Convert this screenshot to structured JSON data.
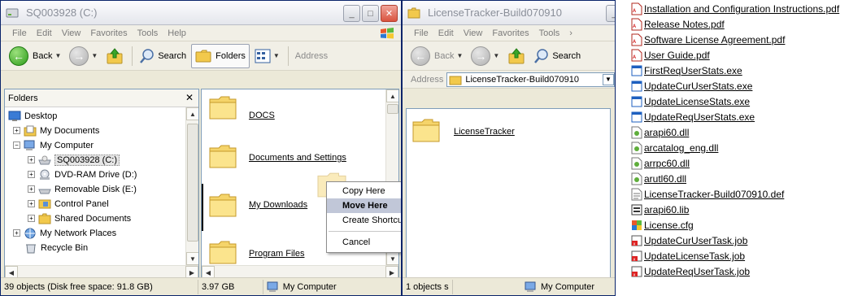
{
  "left_window": {
    "title": "SQ003928 (C:)",
    "menu": [
      "File",
      "Edit",
      "View",
      "Favorites",
      "Tools",
      "Help"
    ],
    "toolbar": {
      "back": "Back",
      "search": "Search",
      "folders": "Folders",
      "address": "Address"
    },
    "folders_pane": {
      "header": "Folders",
      "tree": [
        {
          "label": "Desktop",
          "icon": "desktop-icon"
        },
        {
          "label": "My Documents",
          "icon": "my-documents-icon",
          "expander": "+"
        },
        {
          "label": "My Computer",
          "icon": "my-computer-icon",
          "expander": "−"
        },
        {
          "label": "SQ003928 (C:)",
          "icon": "hard-drive-icon",
          "expander": "+",
          "selected": true
        },
        {
          "label": "DVD-RAM Drive (D:)",
          "icon": "dvd-drive-icon",
          "expander": "+"
        },
        {
          "label": "Removable Disk (E:)",
          "icon": "removable-disk-icon",
          "expander": "+"
        },
        {
          "label": "Control Panel",
          "icon": "control-panel-icon",
          "expander": "+"
        },
        {
          "label": "Shared Documents",
          "icon": "folder-icon",
          "expander": "+"
        },
        {
          "label": "My Network Places",
          "icon": "network-places-icon",
          "expander": "+"
        },
        {
          "label": "Recycle Bin",
          "icon": "recycle-bin-icon"
        }
      ]
    },
    "folder_items": [
      "DOCS",
      "Documents and Settings",
      "My Downloads",
      "Program Files"
    ],
    "context_menu": {
      "items": [
        "Copy Here",
        "Move Here",
        "Create Shortcuts Here"
      ],
      "cancel": "Cancel"
    },
    "status": {
      "objects": "39 objects (Disk free space: 91.8 GB)",
      "size": "3.97 GB",
      "location": "My Computer"
    }
  },
  "middle_window": {
    "title": "LicenseTracker-Build070910",
    "menu": [
      "File",
      "Edit",
      "View",
      "Favorites",
      "Tools"
    ],
    "toolbar": {
      "back": "Back",
      "search": "Search"
    },
    "address_label": "Address",
    "address_value": "LicenseTracker-Build070910",
    "folder_items": [
      "LicenseTracker"
    ],
    "status": {
      "objects": "1 objects s",
      "location": "My Computer"
    }
  },
  "file_list": [
    {
      "name": "Installation and Configuration Instructions.pdf",
      "type": "pdf"
    },
    {
      "name": "Release Notes.pdf",
      "type": "pdf"
    },
    {
      "name": "Software License Agreement.pdf",
      "type": "pdf"
    },
    {
      "name": "User Guide.pdf",
      "type": "pdf"
    },
    {
      "name": "FirstReqUserStats.exe",
      "type": "exe"
    },
    {
      "name": "UpdateCurUserStats.exe",
      "type": "exe"
    },
    {
      "name": "UpdateLicenseStats.exe",
      "type": "exe"
    },
    {
      "name": "UpdateReqUserStats.exe",
      "type": "exe"
    },
    {
      "name": "arapi60.dll",
      "type": "dll"
    },
    {
      "name": "arcatalog_eng.dll",
      "type": "dll"
    },
    {
      "name": "arrpc60.dll",
      "type": "dll"
    },
    {
      "name": "arutl60.dll",
      "type": "dll"
    },
    {
      "name": "LicenseTracker-Build070910.def",
      "type": "def"
    },
    {
      "name": "arapi60.lib",
      "type": "lib"
    },
    {
      "name": "License.cfg",
      "type": "cfg"
    },
    {
      "name": "UpdateCurUserTask.job",
      "type": "job"
    },
    {
      "name": "UpdateLicenseTask.job",
      "type": "job"
    },
    {
      "name": "UpdateReqUserTask.job",
      "type": "job"
    }
  ],
  "colors": {
    "accent": "#0a246a",
    "menu_highlight": "#c1c7d8",
    "folder": "#f2c94c"
  }
}
